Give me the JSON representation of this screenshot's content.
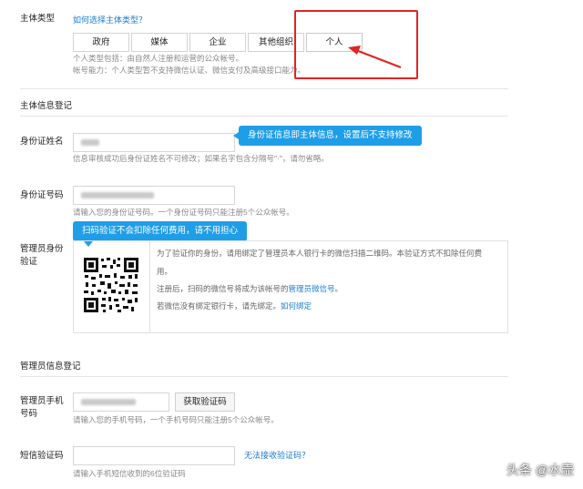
{
  "subject_type": {
    "label": "主体类型",
    "help_link": "如何选择主体类型？",
    "options": [
      "政府",
      "媒体",
      "企业",
      "其他组织",
      "个人"
    ],
    "selected": "个人",
    "desc_line1": "个人类型包括：由自然人注册和运营的公众帐号。",
    "desc_line2": "帐号能力：个人类型暂不支持微信认证、微信支付及高级接口能力。"
  },
  "subject_info": {
    "section_title": "主体信息登记",
    "name_label": "身份证姓名",
    "name_help": "信息审核成功后身份证姓名不可修改；如果名字包含分隔号\"·\"，请勿省略。",
    "name_tip": "身份证信息即主体信息，设置后不支持修改",
    "id_label": "身份证号码",
    "id_help": "请输入您的身份证号码。一个身份证号码只能注册5个公众帐号。",
    "scan_tip": "扫码验证不会扣除任何费用，请不用担心",
    "admin_verify_label_1": "管理员身份",
    "admin_verify_label_2": "验证",
    "qr_text_1": "为了验证你的身份，请用绑定了管理员本人银行卡的微信扫描二维码。本验证方式不扣除任何费",
    "qr_text_1b": "用。",
    "qr_text_2_prefix": "注册后，扫码的微信号将成为该帐号的",
    "qr_text_2_link": "管理员微信号",
    "qr_text_2_suffix": "。",
    "qr_text_3_prefix": "若微信没有绑定银行卡，请先绑定。",
    "qr_text_3_link": "如何绑定"
  },
  "admin_info": {
    "section_title": "管理员信息登记",
    "phone_label_1": "管理员手机",
    "phone_label_2": "号码",
    "get_code_button": "获取验证码",
    "phone_help": "请输入您的手机号码，一个手机号码只能注册5个公众帐号。",
    "sms_label": "短信验证码",
    "sms_link": "无法接收验证码？",
    "sms_help": "请输入手机短信收到的6位验证码"
  },
  "watermark": "头条 @水壶",
  "colors": {
    "accent": "#1f9ee8",
    "link": "#1c7dd4",
    "highlight": "#e02424"
  }
}
